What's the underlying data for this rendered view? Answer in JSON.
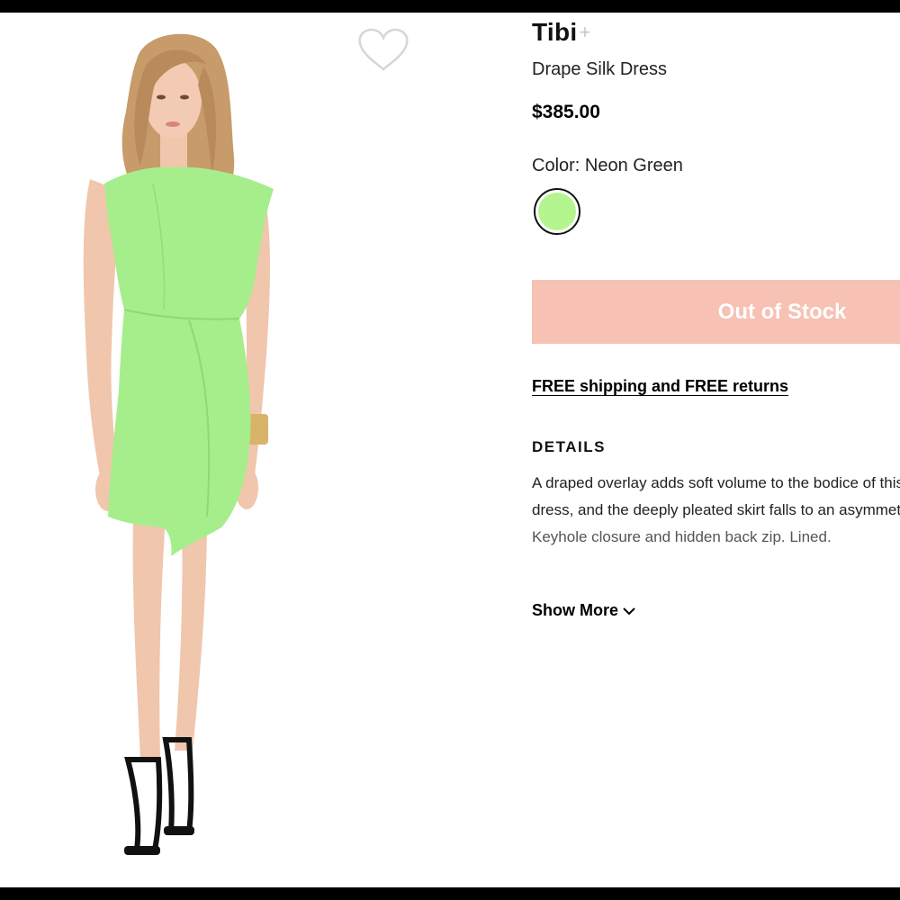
{
  "product": {
    "brand": "Tibi",
    "brand_follow": "+",
    "name": "Drape Silk Dress",
    "price": "$385.00",
    "color_label": "Color: Neon Green",
    "swatch_color": "#b4f58f",
    "out_of_stock_label": "Out of Stock",
    "shipping_link": "FREE shipping and FREE returns",
    "details_heading": "DETAILS",
    "details_lines": [
      "A draped overlay adds soft volume to the bodice of this",
      "dress, and the deeply pleated skirt falls to an asymmetrical hem.",
      "Keyhole closure and hidden back zip. Lined."
    ],
    "show_more_label": "Show More"
  },
  "icons": {
    "wishlist": "heart-outline-icon",
    "show_more": "chevron-down-icon"
  },
  "colors": {
    "button_bg": "#f7c1b4",
    "dress": "#a6ee8c",
    "frame": "#000000"
  }
}
